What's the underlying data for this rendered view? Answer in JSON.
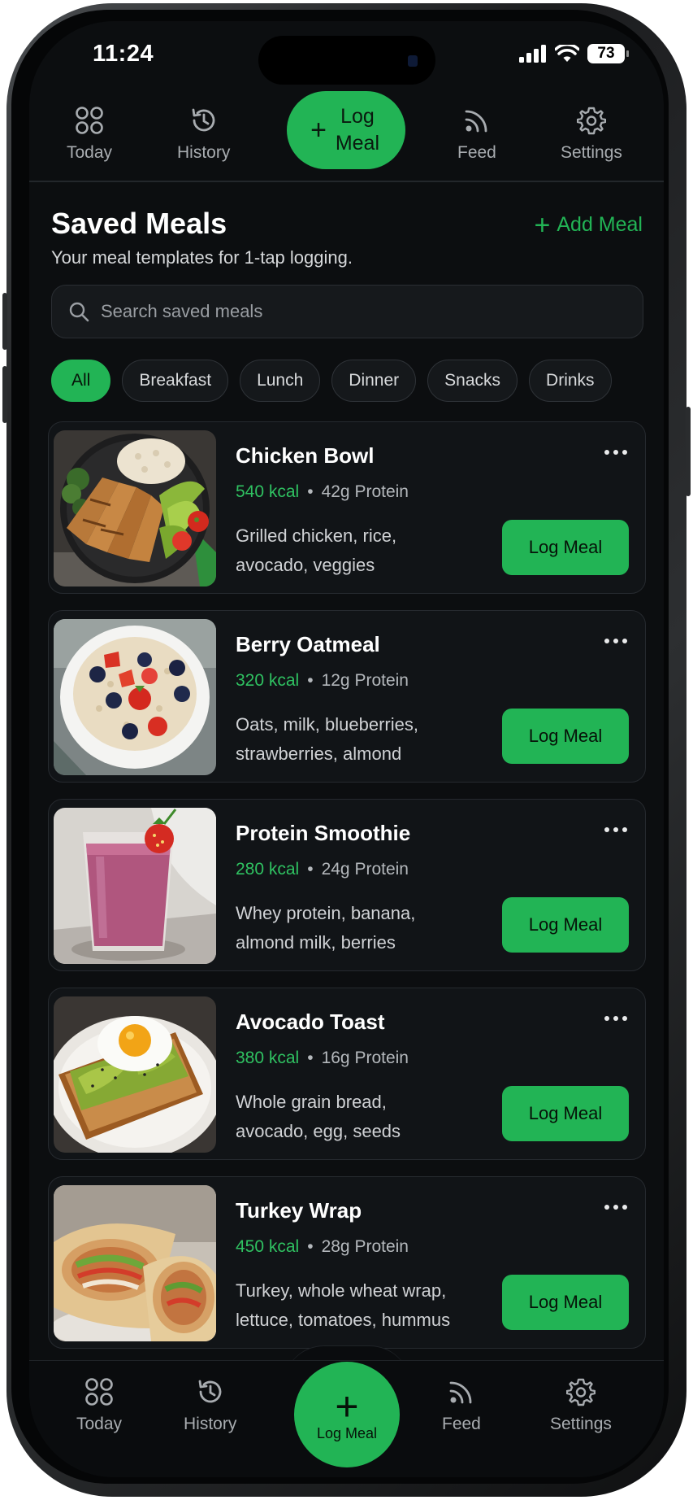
{
  "status_bar": {
    "time": "11:24",
    "battery": "73"
  },
  "top_nav": {
    "today": "Today",
    "history": "History",
    "log_meal": "Log Meal",
    "feed": "Feed",
    "settings": "Settings"
  },
  "header": {
    "title": "Saved Meals",
    "subtitle": "Your meal templates for 1-tap logging.",
    "add_meal": "Add Meal"
  },
  "search": {
    "placeholder": "Search saved meals"
  },
  "filters": [
    "All",
    "Breakfast",
    "Lunch",
    "Dinner",
    "Snacks",
    "Drinks"
  ],
  "meals": [
    {
      "name": "Chicken Bowl",
      "kcal": "540 kcal",
      "protein": "42g Protein",
      "description": "Grilled chicken, rice, avocado, veggies",
      "button": "Log Meal"
    },
    {
      "name": "Berry Oatmeal",
      "kcal": "320 kcal",
      "protein": "12g Protein",
      "description": "Oats, milk, blueberries, strawberries, almond",
      "button": "Log Meal"
    },
    {
      "name": "Protein Smoothie",
      "kcal": "280 kcal",
      "protein": "24g Protein",
      "description": "Whey protein, banana, almond milk, berries",
      "button": "Log Meal"
    },
    {
      "name": "Avocado Toast",
      "kcal": "380 kcal",
      "protein": "16g Protein",
      "description": "Whole grain bread, avocado, egg, seeds",
      "button": "Log Meal"
    },
    {
      "name": "Turkey Wrap",
      "kcal": "450 kcal",
      "protein": "28g Protein",
      "description": "Turkey, whole wheat wrap, lettuce, tomatoes, hummus",
      "button": "Log Meal"
    }
  ],
  "bottom_nav": {
    "today": "Today",
    "history": "History",
    "log_meal": "Log Meal",
    "feed": "Feed",
    "settings": "Settings"
  },
  "colors": {
    "accent": "#22b455",
    "background": "#0c0e10",
    "card": "#111417"
  }
}
